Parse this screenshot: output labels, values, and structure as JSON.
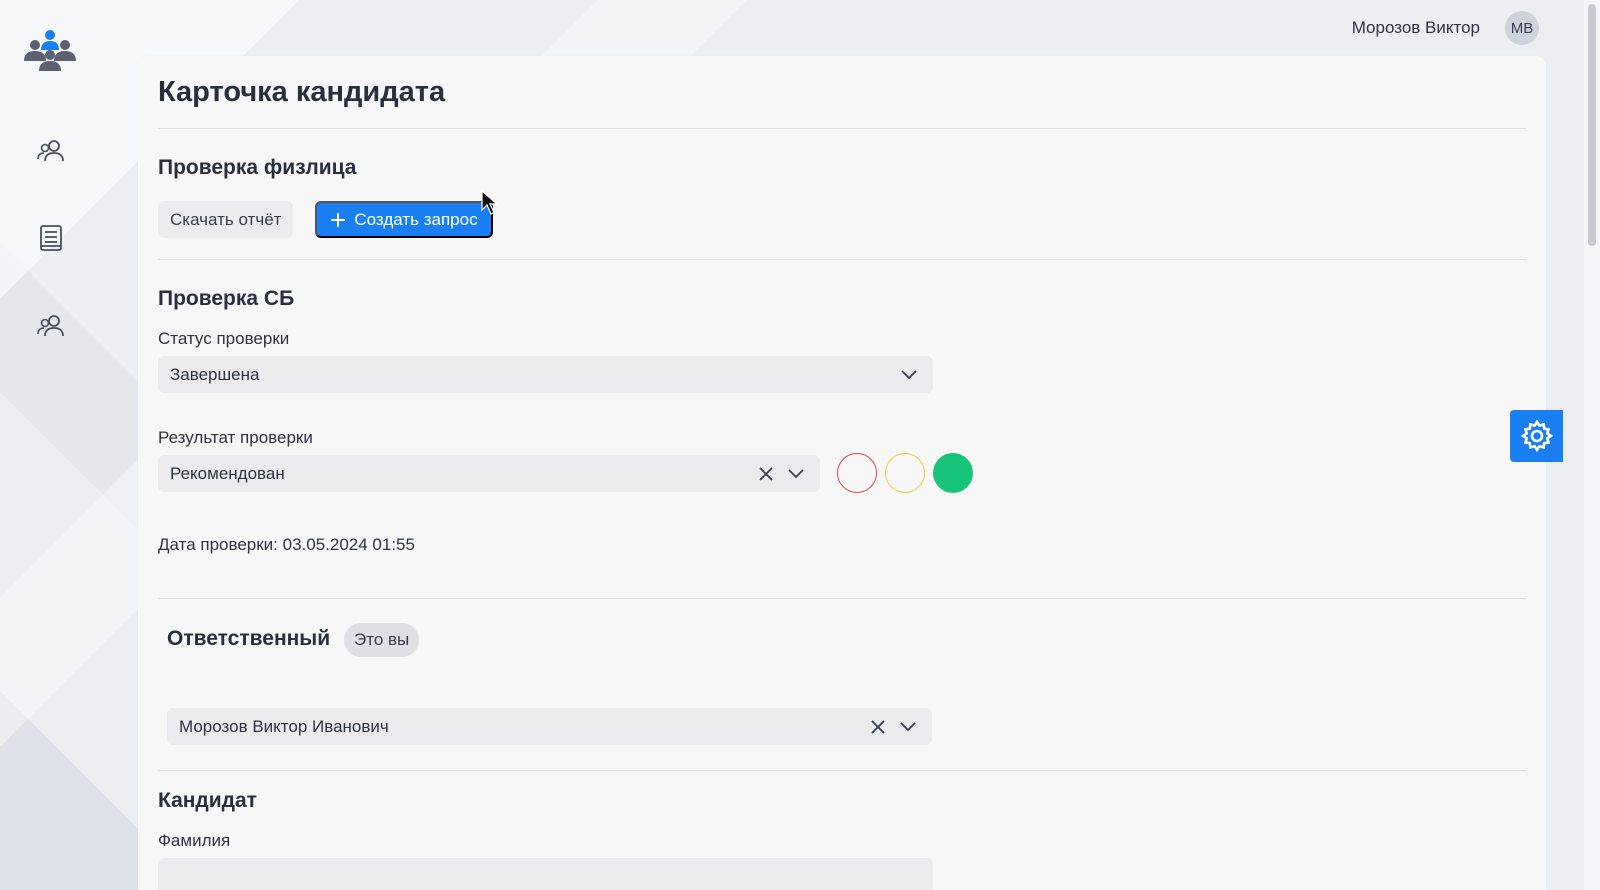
{
  "header": {
    "user_name": "Морозов Виктор",
    "avatar_initials": "МВ"
  },
  "sidebar": {
    "items": [
      {
        "icon": "users-icon"
      },
      {
        "icon": "document-icon"
      },
      {
        "icon": "users-icon"
      }
    ]
  },
  "page": {
    "title": "Карточка кандидата"
  },
  "individual_check": {
    "title": "Проверка физлица",
    "download_label": "Скачать отчёт",
    "create_label": "Создать запрос"
  },
  "security_check": {
    "title": "Проверка СБ",
    "status_label": "Статус проверки",
    "status_value": "Завершена",
    "result_label": "Результат проверки",
    "result_value": "Рекомендован",
    "indicators": [
      {
        "name": "red",
        "color": "#e04848",
        "filled": false
      },
      {
        "name": "yellow",
        "color": "#e8d230",
        "filled": false
      },
      {
        "name": "green",
        "color": "#18c47a",
        "filled": true
      }
    ],
    "date_line": "Дата проверки: 03.05.2024 01:55"
  },
  "responsible": {
    "title": "Ответственный",
    "badge": "Это вы",
    "value": "Морозов Виктор Иванович"
  },
  "candidate": {
    "title": "Кандидат",
    "surname_label": "Фамилия"
  },
  "colors": {
    "accent": "#1a7ff2",
    "background": "#eceef2",
    "card": "#f7f7f8"
  }
}
